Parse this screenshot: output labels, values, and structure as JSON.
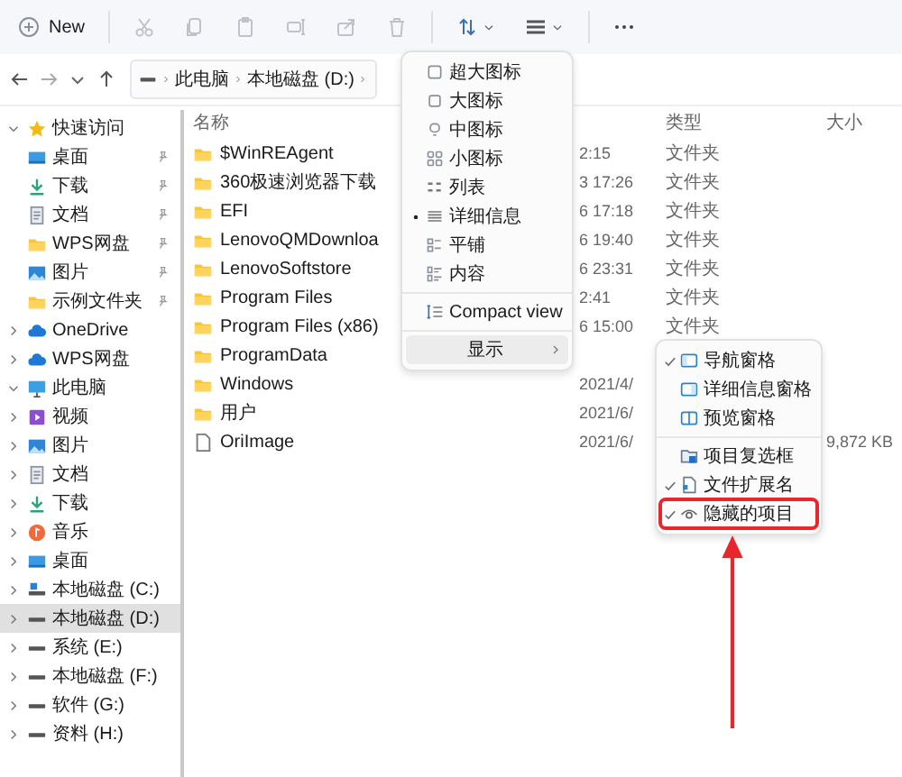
{
  "toolbar": {
    "new_button": {
      "label": "New"
    },
    "tools": [
      {
        "kind": "cut",
        "disabled": true
      },
      {
        "kind": "copy",
        "disabled": true
      },
      {
        "kind": "paste",
        "disabled": true
      },
      {
        "kind": "rename",
        "disabled": true
      },
      {
        "kind": "share",
        "disabled": true
      },
      {
        "kind": "delete",
        "disabled": true
      }
    ],
    "view_buttons": [
      {
        "kind": "sort"
      },
      {
        "kind": "view"
      }
    ]
  },
  "address_bar": {
    "crumbs": [
      "此电脑",
      "本地磁盘 (D:)"
    ]
  },
  "sidebar": {
    "items": [
      {
        "label": "快速访问",
        "kind": "star",
        "expanded": true,
        "selected": false,
        "children": [
          {
            "label": "桌面",
            "kind": "desktop",
            "pinned": true,
            "selected": false
          },
          {
            "label": "下载",
            "kind": "downloads",
            "pinned": true,
            "selected": false
          },
          {
            "label": "文档",
            "kind": "documents",
            "pinned": true,
            "selected": false
          },
          {
            "label": "WPS网盘",
            "kind": "folder",
            "pinned": true,
            "selected": false
          },
          {
            "label": "图片",
            "kind": "pictures",
            "pinned": true,
            "selected": false
          },
          {
            "label": "示例文件夹",
            "kind": "folder",
            "pinned": true,
            "selected": false
          }
        ]
      },
      {
        "label": "OneDrive",
        "kind": "cloud",
        "expanded": false,
        "selected": false
      },
      {
        "label": "WPS网盘",
        "kind": "cloud",
        "expanded": false,
        "selected": false
      },
      {
        "label": "此电脑",
        "kind": "pc",
        "expanded": true,
        "selected": false,
        "children": [
          {
            "label": "视频",
            "kind": "videos",
            "expanded": false,
            "selected": false
          },
          {
            "label": "图片",
            "kind": "pictures",
            "expanded": false,
            "selected": false
          },
          {
            "label": "文档",
            "kind": "documents",
            "expanded": false,
            "selected": false
          },
          {
            "label": "下载",
            "kind": "downloads",
            "expanded": false,
            "selected": false
          },
          {
            "label": "音乐",
            "kind": "music",
            "expanded": false,
            "selected": false
          },
          {
            "label": "桌面",
            "kind": "desktop",
            "expanded": false,
            "selected": false
          },
          {
            "label": "本地磁盘 (C:)",
            "kind": "system-drive",
            "expanded": false,
            "selected": false
          },
          {
            "label": "本地磁盘 (D:)",
            "kind": "drive",
            "expanded": false,
            "selected": true
          },
          {
            "label": "系统 (E:)",
            "kind": "drive",
            "expanded": false,
            "selected": false
          },
          {
            "label": "本地磁盘 (F:)",
            "kind": "drive",
            "expanded": false,
            "selected": false
          },
          {
            "label": "软件 (G:)",
            "kind": "drive",
            "expanded": false,
            "selected": false
          },
          {
            "label": "资料 (H:)",
            "kind": "drive",
            "expanded": false,
            "selected": false
          }
        ]
      }
    ]
  },
  "file_list": {
    "columns": {
      "name": "名称",
      "type": "类型",
      "size": "大小"
    },
    "rows": [
      {
        "name": "$WinREAgent",
        "kind": "folder",
        "date": "2:15",
        "type": "文件夹"
      },
      {
        "name": "360极速浏览器下载",
        "kind": "folder",
        "date": "3 17:26",
        "type": "文件夹"
      },
      {
        "name": "EFI",
        "kind": "folder",
        "date": "6 17:18",
        "type": "文件夹"
      },
      {
        "name": "LenovoQMDownloa",
        "kind": "folder",
        "date": "6 19:40",
        "type": "文件夹"
      },
      {
        "name": "LenovoSoftstore",
        "kind": "folder",
        "date": "6 23:31",
        "type": "文件夹"
      },
      {
        "name": "Program Files",
        "kind": "folder",
        "date": "2:41",
        "type": "文件夹"
      },
      {
        "name": "Program Files (x86)",
        "kind": "folder",
        "date": "6 15:00",
        "type": "文件夹"
      },
      {
        "name": "ProgramData",
        "kind": "folder"
      },
      {
        "name": "Windows",
        "kind": "folder",
        "date": "2021/4/"
      },
      {
        "name": "用户",
        "kind": "folder",
        "date": "2021/6/"
      },
      {
        "name": "OriImage",
        "kind": "file",
        "date": "2021/6/",
        "size": "9,872 KB"
      }
    ]
  },
  "view_menu": {
    "groups": [
      [
        {
          "label": "超大图标",
          "kind": "extra-large",
          "selected": false
        },
        {
          "label": "大图标",
          "kind": "large",
          "selected": false
        },
        {
          "label": "中图标",
          "kind": "medium",
          "selected": false
        },
        {
          "label": "小图标",
          "kind": "small",
          "selected": false
        },
        {
          "label": "列表",
          "kind": "list",
          "selected": false
        },
        {
          "label": "详细信息",
          "kind": "details",
          "selected": true
        },
        {
          "label": "平铺",
          "kind": "tiles",
          "selected": false
        },
        {
          "label": "内容",
          "kind": "content",
          "selected": false
        }
      ],
      [
        {
          "label": "Compact view",
          "kind": "compact",
          "selected": false
        }
      ],
      [
        {
          "label": "显示",
          "kind": "submenu",
          "highlighted": true
        }
      ]
    ]
  },
  "show_submenu": {
    "groups": [
      [
        {
          "label": "导航窗格",
          "kind": "nav-pane",
          "checked": true,
          "annotated": false
        },
        {
          "label": "详细信息窗格",
          "kind": "details-pane",
          "checked": false,
          "annotated": false
        },
        {
          "label": "预览窗格",
          "kind": "preview-pane",
          "checked": false,
          "annotated": false
        }
      ],
      [
        {
          "label": "项目复选框",
          "kind": "checkboxes",
          "checked": false,
          "annotated": false
        },
        {
          "label": "文件扩展名",
          "kind": "extensions",
          "checked": true,
          "annotated": false
        },
        {
          "label": "隐藏的项目",
          "kind": "hidden",
          "checked": true,
          "annotated": true
        }
      ]
    ]
  }
}
